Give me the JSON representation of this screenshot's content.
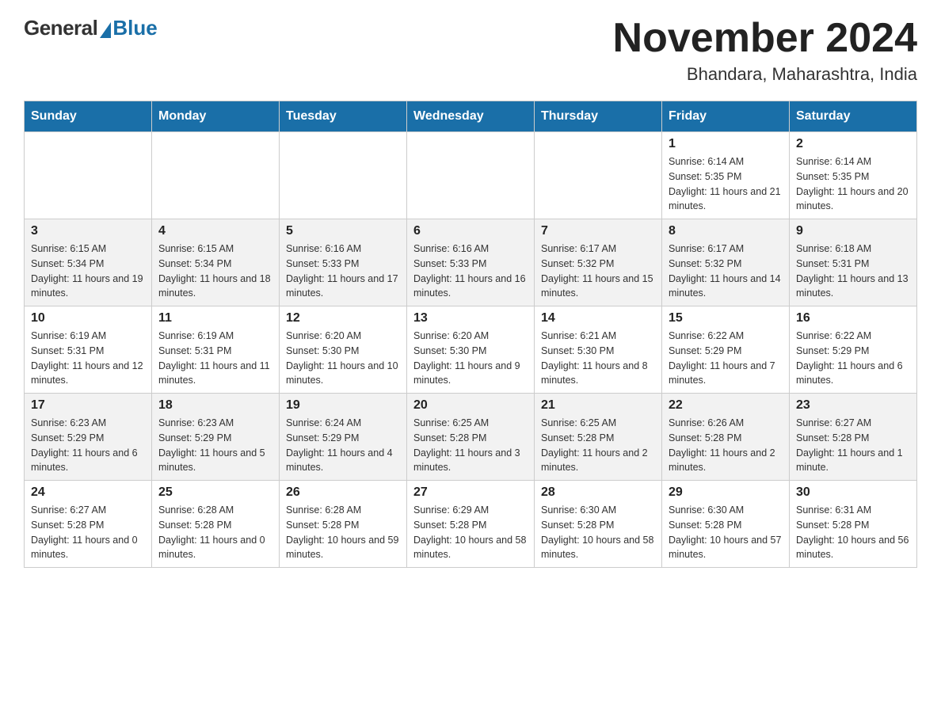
{
  "logo": {
    "general": "General",
    "blue": "Blue"
  },
  "title": "November 2024",
  "location": "Bhandara, Maharashtra, India",
  "days_of_week": [
    "Sunday",
    "Monday",
    "Tuesday",
    "Wednesday",
    "Thursday",
    "Friday",
    "Saturday"
  ],
  "weeks": [
    [
      {
        "day": "",
        "info": ""
      },
      {
        "day": "",
        "info": ""
      },
      {
        "day": "",
        "info": ""
      },
      {
        "day": "",
        "info": ""
      },
      {
        "day": "",
        "info": ""
      },
      {
        "day": "1",
        "info": "Sunrise: 6:14 AM\nSunset: 5:35 PM\nDaylight: 11 hours and 21 minutes."
      },
      {
        "day": "2",
        "info": "Sunrise: 6:14 AM\nSunset: 5:35 PM\nDaylight: 11 hours and 20 minutes."
      }
    ],
    [
      {
        "day": "3",
        "info": "Sunrise: 6:15 AM\nSunset: 5:34 PM\nDaylight: 11 hours and 19 minutes."
      },
      {
        "day": "4",
        "info": "Sunrise: 6:15 AM\nSunset: 5:34 PM\nDaylight: 11 hours and 18 minutes."
      },
      {
        "day": "5",
        "info": "Sunrise: 6:16 AM\nSunset: 5:33 PM\nDaylight: 11 hours and 17 minutes."
      },
      {
        "day": "6",
        "info": "Sunrise: 6:16 AM\nSunset: 5:33 PM\nDaylight: 11 hours and 16 minutes."
      },
      {
        "day": "7",
        "info": "Sunrise: 6:17 AM\nSunset: 5:32 PM\nDaylight: 11 hours and 15 minutes."
      },
      {
        "day": "8",
        "info": "Sunrise: 6:17 AM\nSunset: 5:32 PM\nDaylight: 11 hours and 14 minutes."
      },
      {
        "day": "9",
        "info": "Sunrise: 6:18 AM\nSunset: 5:31 PM\nDaylight: 11 hours and 13 minutes."
      }
    ],
    [
      {
        "day": "10",
        "info": "Sunrise: 6:19 AM\nSunset: 5:31 PM\nDaylight: 11 hours and 12 minutes."
      },
      {
        "day": "11",
        "info": "Sunrise: 6:19 AM\nSunset: 5:31 PM\nDaylight: 11 hours and 11 minutes."
      },
      {
        "day": "12",
        "info": "Sunrise: 6:20 AM\nSunset: 5:30 PM\nDaylight: 11 hours and 10 minutes."
      },
      {
        "day": "13",
        "info": "Sunrise: 6:20 AM\nSunset: 5:30 PM\nDaylight: 11 hours and 9 minutes."
      },
      {
        "day": "14",
        "info": "Sunrise: 6:21 AM\nSunset: 5:30 PM\nDaylight: 11 hours and 8 minutes."
      },
      {
        "day": "15",
        "info": "Sunrise: 6:22 AM\nSunset: 5:29 PM\nDaylight: 11 hours and 7 minutes."
      },
      {
        "day": "16",
        "info": "Sunrise: 6:22 AM\nSunset: 5:29 PM\nDaylight: 11 hours and 6 minutes."
      }
    ],
    [
      {
        "day": "17",
        "info": "Sunrise: 6:23 AM\nSunset: 5:29 PM\nDaylight: 11 hours and 6 minutes."
      },
      {
        "day": "18",
        "info": "Sunrise: 6:23 AM\nSunset: 5:29 PM\nDaylight: 11 hours and 5 minutes."
      },
      {
        "day": "19",
        "info": "Sunrise: 6:24 AM\nSunset: 5:29 PM\nDaylight: 11 hours and 4 minutes."
      },
      {
        "day": "20",
        "info": "Sunrise: 6:25 AM\nSunset: 5:28 PM\nDaylight: 11 hours and 3 minutes."
      },
      {
        "day": "21",
        "info": "Sunrise: 6:25 AM\nSunset: 5:28 PM\nDaylight: 11 hours and 2 minutes."
      },
      {
        "day": "22",
        "info": "Sunrise: 6:26 AM\nSunset: 5:28 PM\nDaylight: 11 hours and 2 minutes."
      },
      {
        "day": "23",
        "info": "Sunrise: 6:27 AM\nSunset: 5:28 PM\nDaylight: 11 hours and 1 minute."
      }
    ],
    [
      {
        "day": "24",
        "info": "Sunrise: 6:27 AM\nSunset: 5:28 PM\nDaylight: 11 hours and 0 minutes."
      },
      {
        "day": "25",
        "info": "Sunrise: 6:28 AM\nSunset: 5:28 PM\nDaylight: 11 hours and 0 minutes."
      },
      {
        "day": "26",
        "info": "Sunrise: 6:28 AM\nSunset: 5:28 PM\nDaylight: 10 hours and 59 minutes."
      },
      {
        "day": "27",
        "info": "Sunrise: 6:29 AM\nSunset: 5:28 PM\nDaylight: 10 hours and 58 minutes."
      },
      {
        "day": "28",
        "info": "Sunrise: 6:30 AM\nSunset: 5:28 PM\nDaylight: 10 hours and 58 minutes."
      },
      {
        "day": "29",
        "info": "Sunrise: 6:30 AM\nSunset: 5:28 PM\nDaylight: 10 hours and 57 minutes."
      },
      {
        "day": "30",
        "info": "Sunrise: 6:31 AM\nSunset: 5:28 PM\nDaylight: 10 hours and 56 minutes."
      }
    ]
  ]
}
